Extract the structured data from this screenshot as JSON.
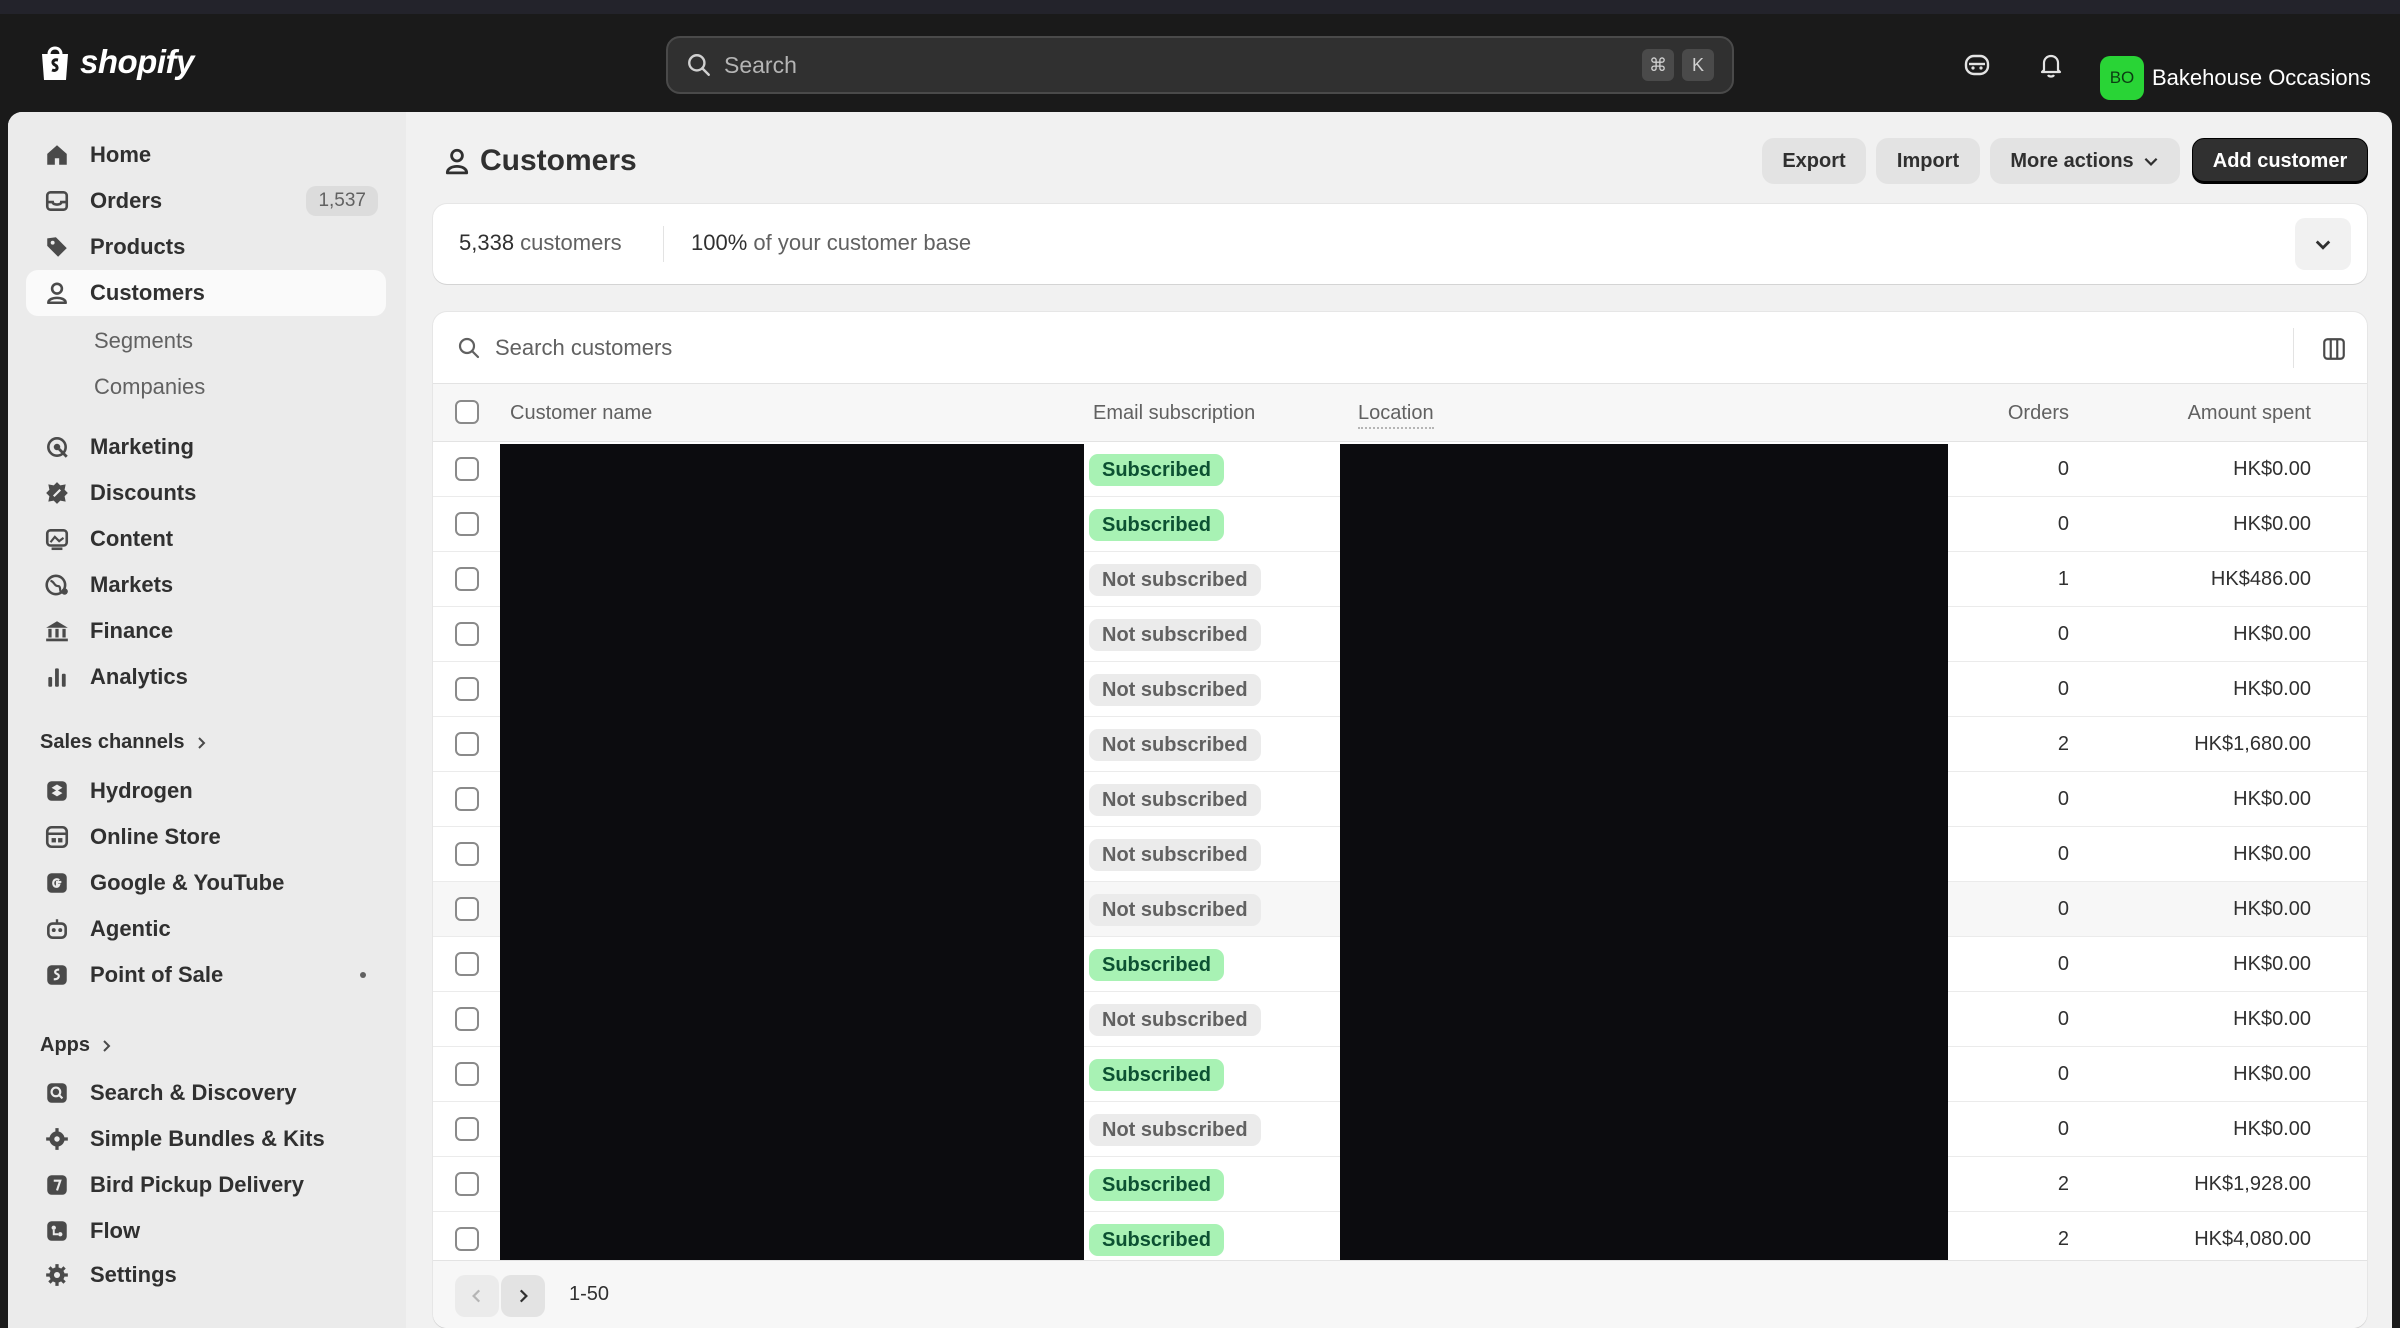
{
  "topbar": {
    "logo_text": "shopify",
    "search_placeholder": "Search",
    "shortcut_keys": [
      "⌘",
      "K"
    ],
    "store_initials": "BO",
    "store_name": "Bakehouse Occasions",
    "icons": [
      "shopify-bag-icon",
      "search-icon",
      "sidekick-icon",
      "bell-icon"
    ]
  },
  "sidebar": {
    "home": "Home",
    "orders": "Orders",
    "orders_count": "1,537",
    "products": "Products",
    "customers": "Customers",
    "segments": "Segments",
    "companies": "Companies",
    "marketing": "Marketing",
    "discounts": "Discounts",
    "content": "Content",
    "markets": "Markets",
    "finance": "Finance",
    "analytics": "Analytics",
    "sales_channels": "Sales channels",
    "hydrogen": "Hydrogen",
    "online_store": "Online Store",
    "google_youtube": "Google & YouTube",
    "agentic": "Agentic",
    "point_of_sale": "Point of Sale",
    "apps": "Apps",
    "search_discovery": "Search & Discovery",
    "simple_bundles": "Simple Bundles & Kits",
    "bird_pickup": "Bird Pickup Delivery",
    "flow": "Flow",
    "settings": "Settings"
  },
  "page": {
    "title": "Customers",
    "export": "Export",
    "import": "Import",
    "more_actions": "More actions",
    "add_customer": "Add customer"
  },
  "summary": {
    "count": "5,338",
    "count_suffix": " customers",
    "percent": "100%",
    "percent_suffix": " of your customer base"
  },
  "table": {
    "search_placeholder": "Search customers",
    "headers": {
      "name": "Customer name",
      "email": "Email subscription",
      "location": "Location",
      "orders": "Orders",
      "amount": "Amount spent"
    },
    "rows": [
      {
        "email": "Subscribed",
        "orders": "0",
        "amount": "HK$0.00"
      },
      {
        "email": "Subscribed",
        "orders": "0",
        "amount": "HK$0.00"
      },
      {
        "email": "Not subscribed",
        "orders": "1",
        "amount": "HK$486.00"
      },
      {
        "email": "Not subscribed",
        "orders": "0",
        "amount": "HK$0.00"
      },
      {
        "email": "Not subscribed",
        "orders": "0",
        "amount": "HK$0.00"
      },
      {
        "email": "Not subscribed",
        "orders": "2",
        "amount": "HK$1,680.00"
      },
      {
        "email": "Not subscribed",
        "orders": "0",
        "amount": "HK$0.00"
      },
      {
        "email": "Not subscribed",
        "orders": "0",
        "amount": "HK$0.00"
      },
      {
        "email": "Not subscribed",
        "orders": "0",
        "amount": "HK$0.00"
      },
      {
        "email": "Subscribed",
        "orders": "0",
        "amount": "HK$0.00"
      },
      {
        "email": "Not subscribed",
        "orders": "0",
        "amount": "HK$0.00"
      },
      {
        "email": "Subscribed",
        "orders": "0",
        "amount": "HK$0.00"
      },
      {
        "email": "Not subscribed",
        "orders": "0",
        "amount": "HK$0.00"
      },
      {
        "email": "Subscribed",
        "orders": "2",
        "amount": "HK$1,928.00"
      },
      {
        "email": "Subscribed",
        "orders": "2",
        "amount": "HK$4,080.00"
      }
    ],
    "pagination_range": "1-50"
  },
  "colors": {
    "subscribed_bg": "#a8f2b4",
    "subscribed_text": "#0c5132",
    "avatar_bg": "#29d436",
    "primary_button": "#303030"
  }
}
